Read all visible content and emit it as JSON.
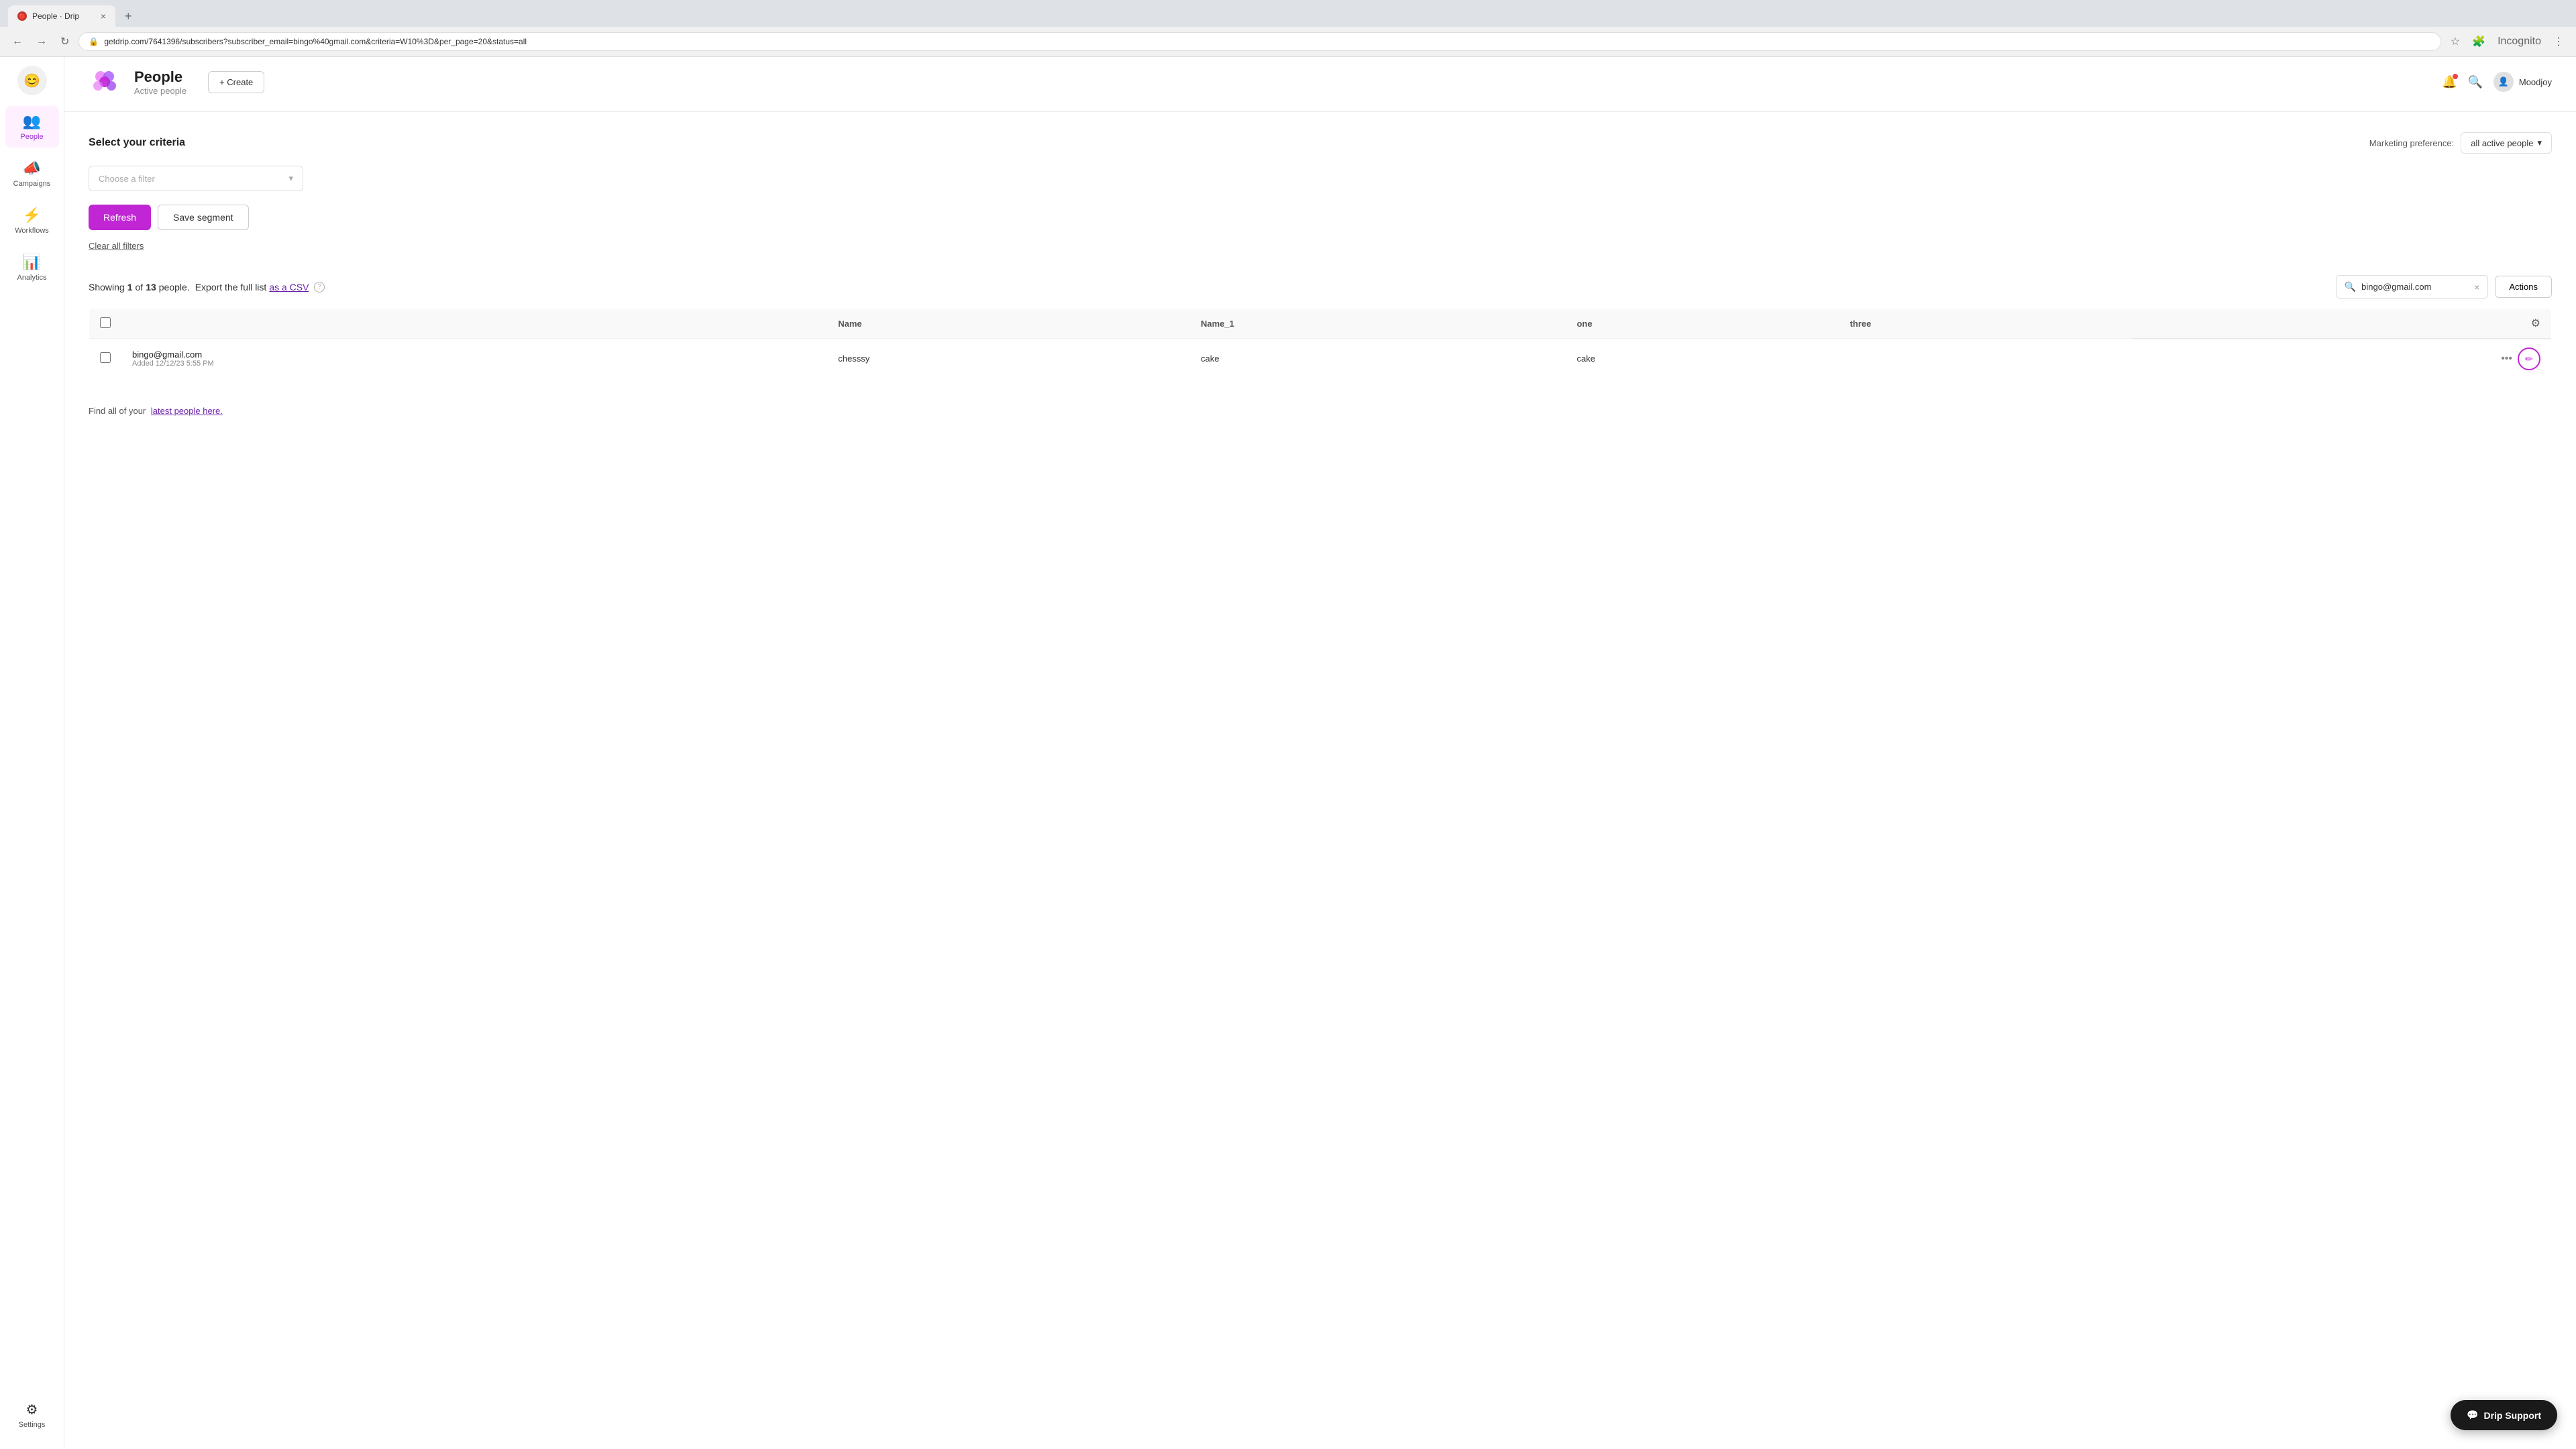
{
  "browser": {
    "tab_title": "People · Drip",
    "tab_close": "×",
    "new_tab": "+",
    "nav_back": "←",
    "nav_forward": "→",
    "nav_refresh": "↻",
    "address": "getdrip.com/7641396/subscribers?subscriber_email=bingo%40gmail.com&criteria=W10%3D&per_page=20&status=all",
    "star_icon": "☆",
    "profile_ext": "Incognito",
    "menu_icon": "⋮"
  },
  "sidebar": {
    "logo_emoji": "😊",
    "items": [
      {
        "id": "people",
        "label": "People",
        "icon": "👥",
        "active": true
      },
      {
        "id": "campaigns",
        "label": "Campaigns",
        "icon": "📣",
        "active": false
      },
      {
        "id": "workflows",
        "label": "Workflows",
        "icon": "⚡",
        "active": false
      },
      {
        "id": "analytics",
        "label": "Analytics",
        "icon": "📊",
        "active": false
      }
    ],
    "settings_label": "Settings",
    "settings_icon": "⚙"
  },
  "header": {
    "page_title": "People",
    "page_subtitle": "Active people",
    "create_label": "+ Create",
    "user_name": "Moodjoy"
  },
  "criteria": {
    "section_title": "Select your criteria",
    "marketing_pref_label": "Marketing preference:",
    "marketing_pref_value": "all active people",
    "filter_placeholder": "Choose a filter",
    "refresh_label": "Refresh",
    "save_segment_label": "Save segment",
    "clear_filters_label": "Clear all filters"
  },
  "people_list": {
    "showing_text": "Showing",
    "count_shown": "1",
    "count_of": "of",
    "count_total": "13",
    "count_suffix": "people.",
    "export_text": "Export the full list",
    "export_link_text": "as a CSV",
    "search_value": "bingo@gmail.com",
    "actions_label": "Actions",
    "columns": [
      {
        "id": "name",
        "label": "Name"
      },
      {
        "id": "name1",
        "label": "Name_1"
      },
      {
        "id": "one",
        "label": "one"
      },
      {
        "id": "three",
        "label": "three"
      }
    ],
    "rows": [
      {
        "email": "bingo@gmail.com",
        "added": "Added 12/12/23 5:55 PM",
        "name": "chesssy",
        "name1": "cake",
        "one": "cake",
        "three": ""
      }
    ]
  },
  "footer": {
    "find_text": "Find all of your",
    "latest_link": "latest people here.",
    "period": ""
  },
  "support": {
    "label": "Drip Support"
  }
}
